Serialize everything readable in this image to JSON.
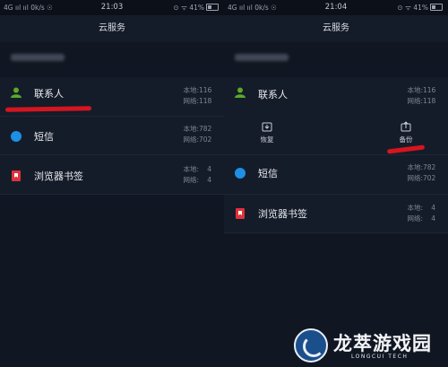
{
  "left": {
    "status": {
      "carrier": "4G ııl ııl  0k/s  ☉",
      "time": "21:03",
      "right": "⊙ ᯤ 41%"
    },
    "title": "云服务",
    "items": [
      {
        "label": "联系人",
        "local_label": "本地:",
        "local_value": "116",
        "net_label": "网络:",
        "net_value": "118"
      },
      {
        "label": "短信",
        "local_label": "本地:",
        "local_value": "782",
        "net_label": "网络:",
        "net_value": "702"
      },
      {
        "label": "浏览器书签",
        "local_label": "本地:",
        "local_value": "4",
        "net_label": "网络:",
        "net_value": "4"
      }
    ]
  },
  "right": {
    "status": {
      "carrier": "4G ııl ııl  0k/s  ☉",
      "time": "21:04",
      "right": "⊙ ᯤ 41%"
    },
    "title": "云服务",
    "items": [
      {
        "label": "联系人",
        "local_label": "本地:",
        "local_value": "116",
        "net_label": "网络:",
        "net_value": "118"
      },
      {
        "label": "短信",
        "local_label": "本地:",
        "local_value": "782",
        "net_label": "网络:",
        "net_value": "702"
      },
      {
        "label": "浏览器书签",
        "local_label": "本地:",
        "local_value": "4",
        "net_label": "网络:",
        "net_value": "4"
      }
    ],
    "actions": {
      "restore": "恢复",
      "backup": "备份"
    }
  },
  "watermark": {
    "title": "龙萃游戏园",
    "subtitle": "LONGCUI TECH"
  },
  "colors": {
    "underline": "#d5151f",
    "contact": "#5aa82a",
    "sms": "#1e8fe6",
    "bookmark": "#e0313b",
    "background": "#111722"
  }
}
